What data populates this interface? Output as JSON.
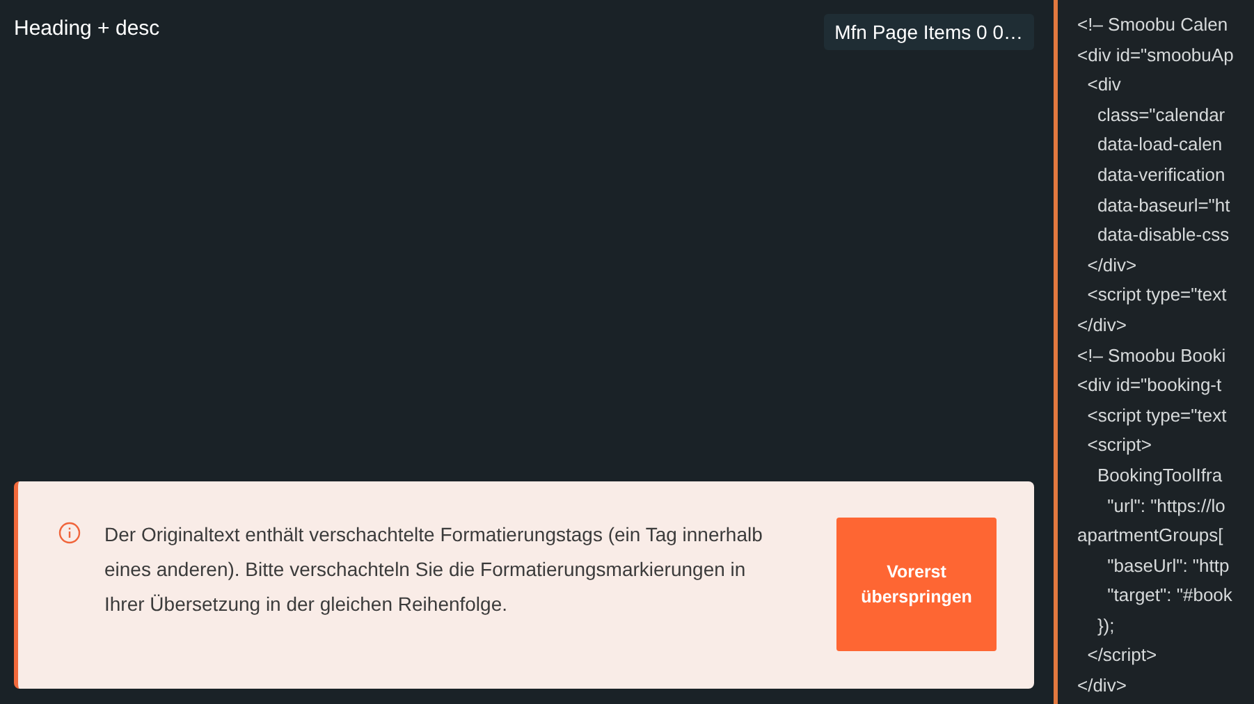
{
  "heading": "Heading + desc",
  "badge": "Mfn Page Items 0 0…",
  "alert": {
    "text": "Der Originaltext enthält verschachtelte Formatierungstags (ein Tag innerhalb eines anderen). Bitte verschachteln Sie die Formatierungsmarkierungen in Ihrer Übersetzung in der gleichen Reihenfolge.",
    "button": "Vorerst überspringen"
  },
  "code_lines": [
    "<!– Smoobu Calen",
    "<div id=\"smoobuAp",
    "  <div",
    "    class=\"calendar",
    "    data-load-calen",
    "    data-verification",
    "    data-baseurl=\"ht",
    "    data-disable-css",
    "  </div>",
    "  <script type=\"text",
    "</div>",
    "<!– Smoobu Booki",
    "<div id=\"booking-t",
    "  <script type=\"text",
    "  <script>",
    "    BookingToolIfra",
    "      \"url\": \"https://lo",
    "apartmentGroups[",
    "      \"baseUrl\": \"http",
    "      \"target\": \"#book",
    "    });",
    "  </script>",
    "</div>"
  ]
}
